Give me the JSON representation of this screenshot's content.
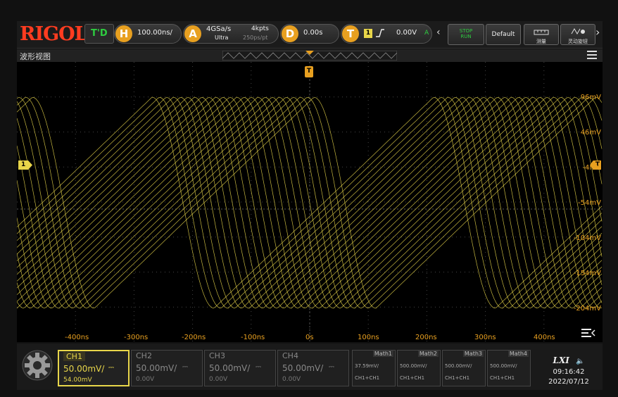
{
  "brand": "RIGOL",
  "colors": {
    "ch1": "#e8d64a",
    "accent": "#e8a020",
    "brand": "#ff3c20",
    "run_stop": "#2ecc40"
  },
  "topbar": {
    "mode": "T'D",
    "horizontal": {
      "key": "H",
      "value": "100.00ns/"
    },
    "acquire": {
      "key": "A",
      "rate": "4GSa/s",
      "depth": "4kpts",
      "mode": "Ultra",
      "resolution": "250ps/pt"
    },
    "delay": {
      "key": "D",
      "value": "0.00s"
    },
    "trigger": {
      "key": "T",
      "source": "1",
      "level": "0.00V",
      "mode": "A"
    },
    "run_stop": {
      "line1": "STOP",
      "line2": "RUN"
    },
    "default_label": "Default",
    "measure_label": "测量",
    "knob_label": "灵动旋钮"
  },
  "view": {
    "title": "波形视图",
    "trigger_marker": "T",
    "ch1_marker": "1",
    "level_marker": "T"
  },
  "x_labels": [
    "-400ns",
    "-300ns",
    "-200ns",
    "-100ns",
    "0s",
    "100ns",
    "200ns",
    "300ns",
    "400ns"
  ],
  "y_labels": [
    "96mV",
    "46mV",
    "-4mV",
    "-54mV",
    "-104mV",
    "-154mV",
    "-204mV"
  ],
  "channels": [
    {
      "name": "CH1",
      "scale": "50.00mV/",
      "offset": "54.00mV",
      "active": true
    },
    {
      "name": "CH2",
      "scale": "50.00mV/",
      "offset": "0.00V",
      "active": false
    },
    {
      "name": "CH3",
      "scale": "50.00mV/",
      "offset": "0.00V",
      "active": false
    },
    {
      "name": "CH4",
      "scale": "50.00mV/",
      "offset": "0.00V",
      "active": false
    }
  ],
  "math": [
    {
      "name": "Math1",
      "value": "37.59mV/",
      "source": "CH1+CH1"
    },
    {
      "name": "Math2",
      "value": "500.00mV/",
      "source": "CH1+CH1"
    },
    {
      "name": "Math3",
      "value": "500.00mV/",
      "source": "CH1+CH1"
    },
    {
      "name": "Math4",
      "value": "500.00mV/",
      "source": "CH1+CH1"
    }
  ],
  "status": {
    "lxi": "LXI",
    "time": "09:16:42",
    "date": "2022/07/12"
  }
}
